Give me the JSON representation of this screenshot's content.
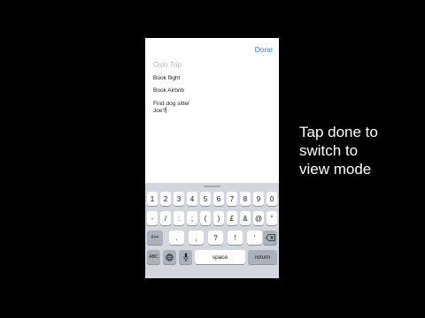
{
  "toolbar": {
    "done_label": "Done"
  },
  "note": {
    "title": "Oslo Trip",
    "lines": [
      "Book flight",
      "Book Airbnb",
      "Find dog sitter",
      "Joe?"
    ]
  },
  "keyboard": {
    "row1": [
      "1",
      "2",
      "3",
      "4",
      "5",
      "6",
      "7",
      "8",
      "9",
      "0"
    ],
    "row2": [
      "-",
      "/",
      ":",
      ";",
      "(",
      ")",
      "£",
      "&",
      "@",
      "\""
    ],
    "row3_shift": "#+=",
    "row3": [
      ".",
      ",",
      "?",
      "!",
      "'"
    ],
    "row4": {
      "abc": "ABC",
      "space": "space",
      "return": "return"
    },
    "icons": {
      "delete": "backspace-icon",
      "globe": "globe-icon",
      "mic": "microphone-icon"
    }
  },
  "caption": {
    "line1": "Tap done to",
    "line2": "switch to",
    "line3": "view mode"
  }
}
